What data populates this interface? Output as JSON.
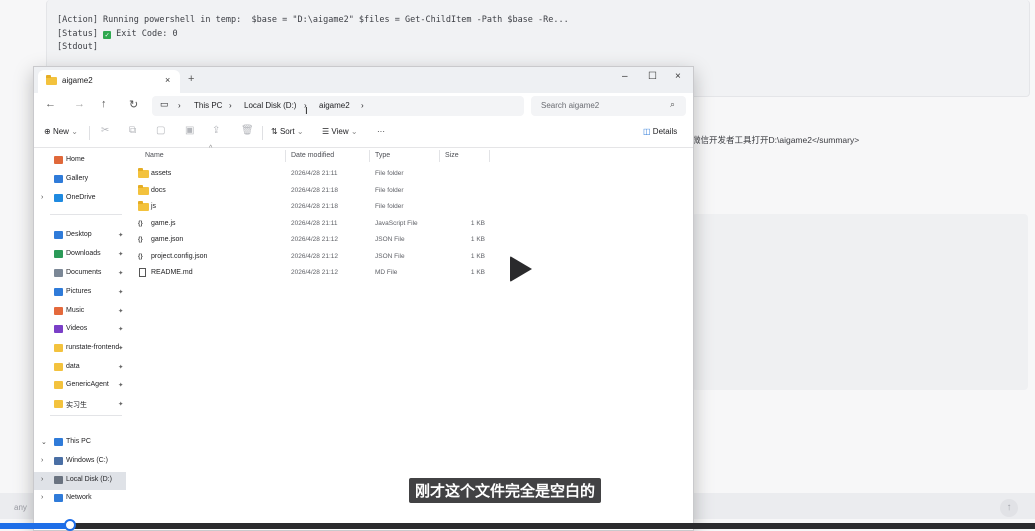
{
  "log": {
    "line1": "[Action] Running powershell in temp:  $base = \"D:\\aigame2\" $files = Get-ChildItem -Path $base -Re...",
    "line2_prefix": "[Status] ",
    "line2_suffix": " Exit Code: 0",
    "line3": "[Stdout]"
  },
  "summary_text": "微信开发者工具打开D:\\aigame2</summary>",
  "bottom_input_text": "any",
  "send_icon": "↑",
  "explorer": {
    "tab_title": "aigame2",
    "tab_close": "×",
    "new_tab": "+",
    "window_controls": {
      "minimize": "–",
      "maximize": "☐",
      "close": "×"
    },
    "nav": {
      "back": "←",
      "forward": "→",
      "up": "↑",
      "refresh": "↻"
    },
    "breadcrumb": [
      "This PC",
      "Local Disk (D:)",
      "aigame2"
    ],
    "breadcrumb_sep": "›",
    "search_placeholder": "Search aigame2",
    "toolbar": {
      "new": "New",
      "sort": "Sort",
      "view": "View",
      "more": "···",
      "details": "Details"
    },
    "sidebar": [
      {
        "label": "Home",
        "icon": "home-icon",
        "color": "#e0683a"
      },
      {
        "label": "Gallery",
        "icon": "gallery-icon",
        "color": "#2f7bd9"
      },
      {
        "label": "OneDrive",
        "icon": "cloud-icon",
        "color": "#1f8ae0"
      },
      {
        "label": "Desktop",
        "icon": "desktop-icon",
        "color": "#2f7bd9"
      },
      {
        "label": "Downloads",
        "icon": "download-icon",
        "color": "#2b9a58"
      },
      {
        "label": "Documents",
        "icon": "document-icon",
        "color": "#7b8796"
      },
      {
        "label": "Pictures",
        "icon": "pictures-icon",
        "color": "#2f7bd9"
      },
      {
        "label": "Music",
        "icon": "music-icon",
        "color": "#e4693c"
      },
      {
        "label": "Videos",
        "icon": "videos-icon",
        "color": "#7a3fc7"
      },
      {
        "label": "runstate-frontend",
        "icon": "folder-icon",
        "color": "#f3c23d"
      },
      {
        "label": "data",
        "icon": "folder-icon",
        "color": "#f3c23d"
      },
      {
        "label": "GenericAgent",
        "icon": "folder-icon",
        "color": "#f3c23d"
      },
      {
        "label": "实习生",
        "icon": "folder-icon",
        "color": "#f3c23d"
      },
      {
        "label": "This PC",
        "icon": "pc-icon",
        "color": "#2f7bd9"
      },
      {
        "label": "Windows (C:)",
        "icon": "drive-icon",
        "color": "#4a6fa5"
      },
      {
        "label": "Local Disk (D:)",
        "icon": "drive-icon",
        "color": "#6a7380"
      },
      {
        "label": "Network",
        "icon": "network-icon",
        "color": "#2f7bd9"
      }
    ],
    "columns": {
      "name": "Name",
      "date": "Date modified",
      "type": "Type",
      "size": "Size"
    },
    "files": [
      {
        "name": "assets",
        "date": "2026/4/28 21:11",
        "type": "File folder",
        "size": "",
        "kind": "folder"
      },
      {
        "name": "docs",
        "date": "2026/4/28 21:18",
        "type": "File folder",
        "size": "",
        "kind": "folder"
      },
      {
        "name": "js",
        "date": "2026/4/28 21:18",
        "type": "File folder",
        "size": "",
        "kind": "folder"
      },
      {
        "name": "game.js",
        "date": "2026/4/28 21:11",
        "type": "JavaScript File",
        "size": "1 KB",
        "kind": "code"
      },
      {
        "name": "game.json",
        "date": "2026/4/28 21:12",
        "type": "JSON File",
        "size": "1 KB",
        "kind": "code"
      },
      {
        "name": "project.config.json",
        "date": "2026/4/28 21:12",
        "type": "JSON File",
        "size": "1 KB",
        "kind": "code"
      },
      {
        "name": "README.md",
        "date": "2026/4/28 21:12",
        "type": "MD File",
        "size": "1 KB",
        "kind": "doc"
      }
    ]
  },
  "video": {
    "subtitle": "刚才这个文件完全是空白的",
    "progress_fraction": 0.068
  }
}
